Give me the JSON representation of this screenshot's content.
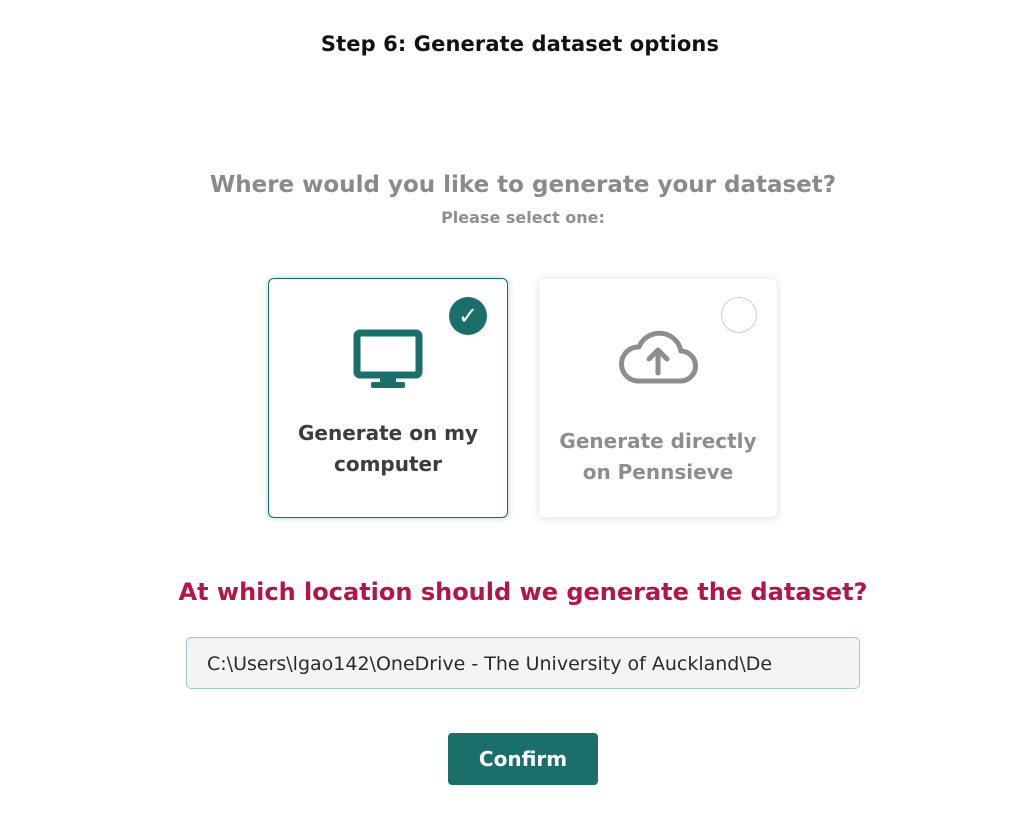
{
  "step": {
    "title": "Step 6: Generate dataset options"
  },
  "question": {
    "heading": "Where would you like to generate your dataset?",
    "subheading": "Please select one:"
  },
  "options": [
    {
      "label": "Generate on my computer",
      "icon": "monitor-icon",
      "selected": true
    },
    {
      "label": "Generate directly on Pennsieve",
      "icon": "cloud-upload-icon",
      "selected": false
    }
  ],
  "location": {
    "question": "At which location should we generate the dataset?",
    "path_value": "C:\\Users\\lgao142\\OneDrive - The University of Auckland\\De"
  },
  "actions": {
    "confirm_label": "Confirm"
  },
  "colors": {
    "accent": "#1a6f6a",
    "highlight": "#b3154a",
    "muted_text": "#8a8a8a"
  }
}
